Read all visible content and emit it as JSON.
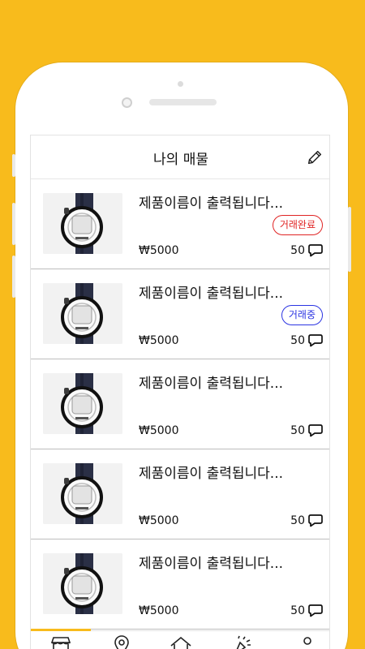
{
  "header": {
    "title": "나의 매물",
    "edit_icon": "pencil-icon"
  },
  "items": [
    {
      "name": "제품이름이 출력됩니다...",
      "badge": "거래완료",
      "badge_type": "done",
      "price": "₩5000",
      "chat_count": "50"
    },
    {
      "name": "제품이름이 출력됩니다...",
      "badge": "거래중",
      "badge_type": "ing",
      "price": "₩5000",
      "chat_count": "50"
    },
    {
      "name": "제품이름이 출력됩니다...",
      "badge": "",
      "badge_type": "",
      "price": "₩5000",
      "chat_count": "50"
    },
    {
      "name": "제품이름이 출력됩니다...",
      "badge": "",
      "badge_type": "",
      "price": "₩5000",
      "chat_count": "50"
    },
    {
      "name": "제품이름이 출력됩니다...",
      "badge": "",
      "badge_type": "",
      "price": "₩5000",
      "chat_count": "50"
    }
  ],
  "tabbar": {
    "tabs": [
      {
        "icon": "store-icon",
        "active": true
      },
      {
        "icon": "location-pin-icon",
        "active": false
      },
      {
        "icon": "home-icon",
        "active": false
      },
      {
        "icon": "celebration-icon",
        "active": false
      },
      {
        "icon": "person-icon",
        "active": false
      }
    ]
  },
  "colors": {
    "background": "#F8BB1C",
    "badge_done": "#E02424",
    "badge_ing": "#2B34E2",
    "tab_indicator": "#F8BB1C"
  }
}
